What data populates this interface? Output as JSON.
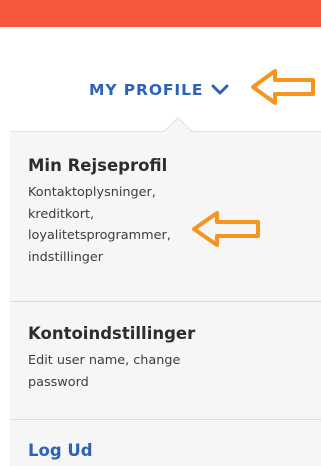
{
  "header": {
    "profile_menu_label": "MY PROFILE",
    "profile_menu_icon": "chevron-down-icon"
  },
  "menu": {
    "items": [
      {
        "title": "Min Rejseprofil",
        "description": "Kontaktoplysninger,\nkreditkort,\nloyalitetsprogrammer,\nindstillinger"
      },
      {
        "title": "Kontoindstillinger",
        "description": "Edit user name, change\npassword"
      }
    ],
    "logout_label": "Log Ud"
  },
  "colors": {
    "brand_bar": "#f5583a",
    "link_blue": "#2b63b6",
    "annotation_arrow": "#f7941d"
  }
}
